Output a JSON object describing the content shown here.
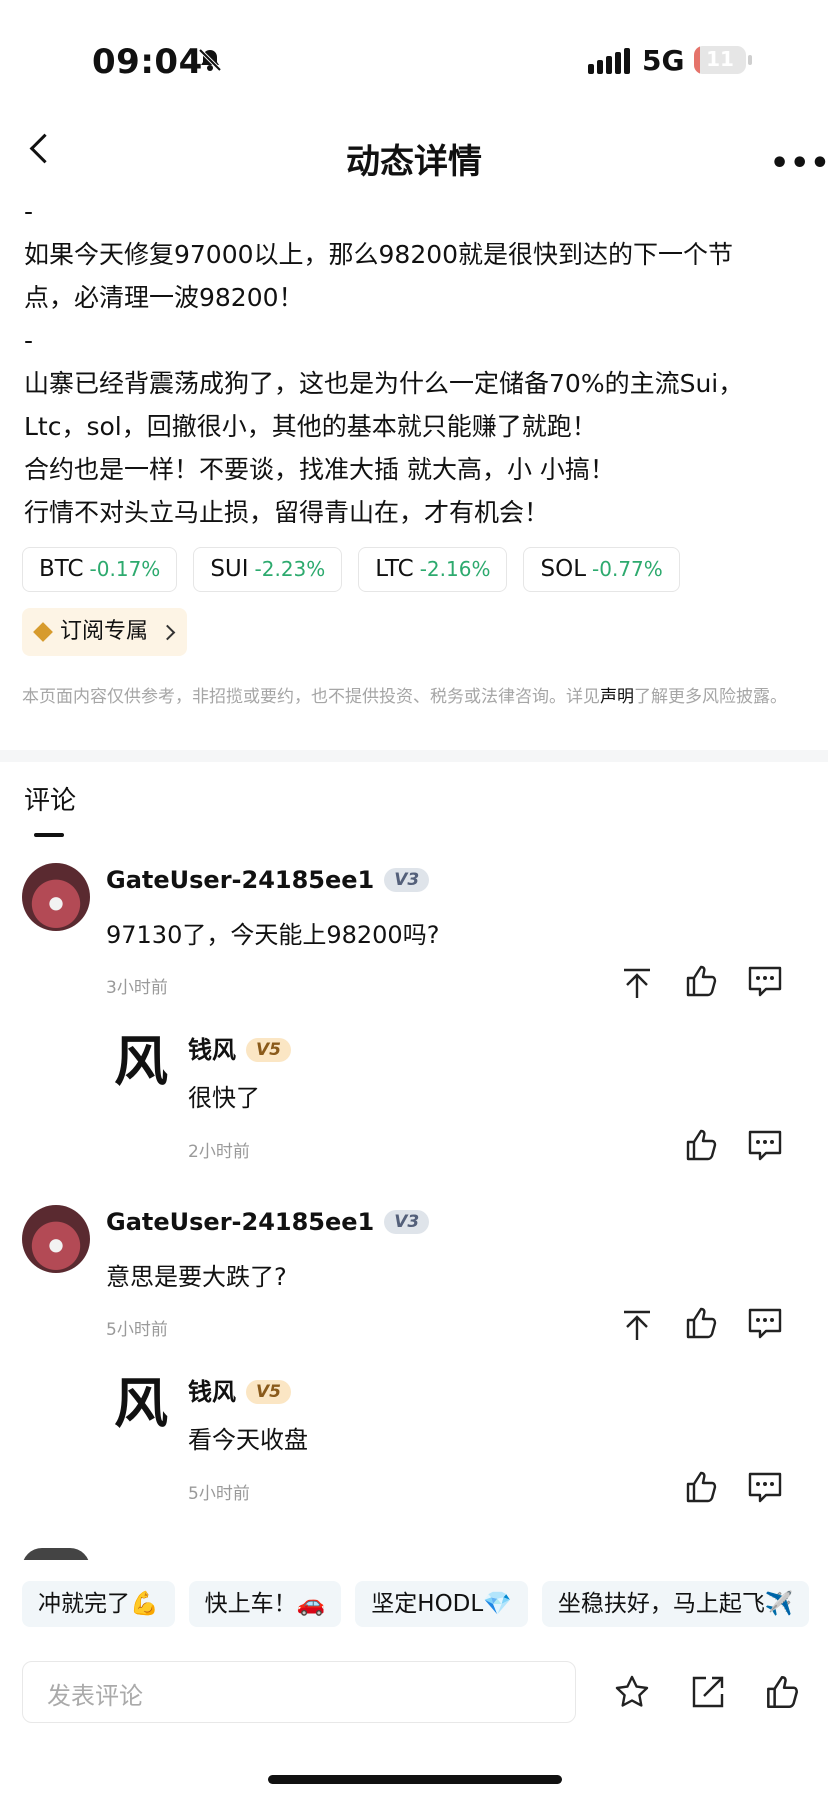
{
  "status_bar": {
    "time": "09:04",
    "network": "5G",
    "battery": "11",
    "battery_level": 0.11
  },
  "header": {
    "title": "动态详情"
  },
  "post": {
    "lines": [
      "-",
      "如果今天修复97000以上，那么98200就是很快到达的下一个节",
      "点，必清理一波98200！",
      "-",
      "山寨已经背震荡成狗了，这也是为什么一定储备70%的主流Sui，",
      "Ltc，sol，回撤很小，其他的基本就只能赚了就跑！",
      "合约也是一样！不要谈，找准大插 就大高，小 小搞！",
      "行情不对头立马止损，留得青山在，才有机会！"
    ],
    "tickers": [
      {
        "symbol": "BTC",
        "change": "-0.17%"
      },
      {
        "symbol": "SUI",
        "change": "-2.23%"
      },
      {
        "symbol": "LTC",
        "change": "-2.16%"
      },
      {
        "symbol": "SOL",
        "change": "-0.77%"
      }
    ],
    "subscribe_label": "订阅专属",
    "disclaimer_a": "本页面内容仅供参考，非招揽或要约，也不提供投资、税务或法律咨询。详见",
    "disclaimer_link": "声明",
    "disclaimer_b": "了解更多风险披露。"
  },
  "comments_title": "评论",
  "comments": [
    {
      "user": "GateUser-24185ee1",
      "level": "V3",
      "text": "97130了，今天能上98200吗?",
      "time": "3小时前",
      "reply": {
        "user": "钱风",
        "avatar_char": "风",
        "level": "V5",
        "text": "很快了",
        "time": "2小时前"
      }
    },
    {
      "user": "GateUser-24185ee1",
      "level": "V3",
      "text": "意思是要大跌了?",
      "time": "5小时前",
      "reply": {
        "user": "钱风",
        "avatar_char": "风",
        "level": "V5",
        "text": "看今天收盘",
        "time": "5小时前"
      }
    }
  ],
  "quick_replies": [
    "冲就完了💪",
    "快上车！🚗",
    "坚定HODL💎",
    "坐稳扶好，马上起飞✈️"
  ],
  "composer": {
    "placeholder": "发表评论"
  },
  "icons": {
    "status": [
      "bell-slash-icon",
      "signal-icon",
      "battery-icon"
    ],
    "header": [
      "back-arrow-icon",
      "more-icon"
    ],
    "comment_actions": [
      "pin-top-icon",
      "thumb-up-icon",
      "comment-bubble-icon"
    ],
    "footer": [
      "star-icon",
      "share-icon",
      "thumb-up-icon"
    ]
  },
  "colors": {
    "positive_green": "#2daa6e",
    "badge_v3": "#dfe4ea",
    "badge_v5": "#fbe6c4",
    "subscribe_bg": "#fdf4e5"
  }
}
